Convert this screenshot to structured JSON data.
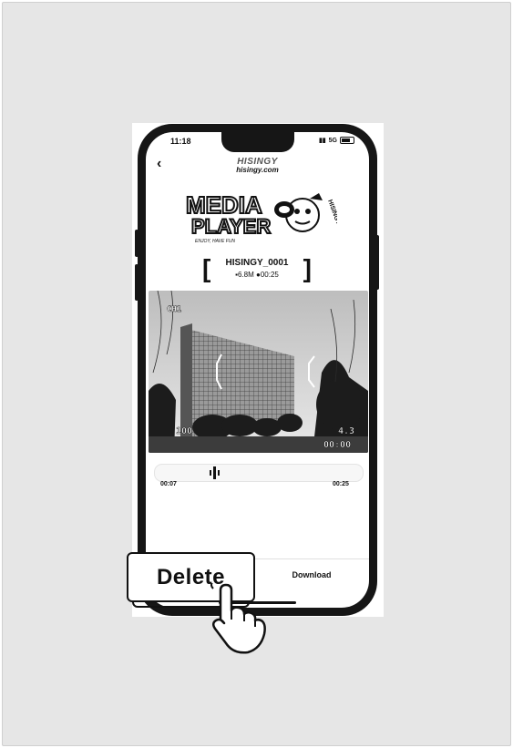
{
  "status_bar": {
    "time": "11:18",
    "network": "5G"
  },
  "header": {
    "brand_name": "HISINGY",
    "brand_url": "hisingy.com"
  },
  "logo": {
    "line1": "MEDIA",
    "line2": "PLAYER",
    "tagline": "ENJOY, HAVE FUN",
    "side_text": "HISINGY"
  },
  "file": {
    "name": "HISINGY_0001",
    "size": "6.8M",
    "duration": "00:25"
  },
  "video_overlay": {
    "channel": "CH1",
    "left_value": "100",
    "right_value": "4.3",
    "timecode": "00:00"
  },
  "timeline": {
    "current": "00:07",
    "total": "00:25",
    "progress": 0.28
  },
  "actions": {
    "delete_label": "Delete",
    "download_label": "Download"
  },
  "colors": {
    "background": "#e6e6e6",
    "phone": "#161616",
    "accent": "#111111"
  }
}
